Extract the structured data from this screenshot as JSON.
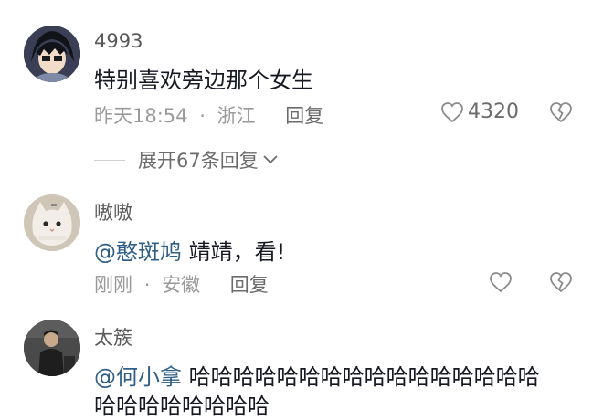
{
  "comments": [
    {
      "username": "4993",
      "text": "特别喜欢旁边那个女生",
      "time": "昨天18:54",
      "separator": "·",
      "location": "浙江",
      "reply_label": "回复",
      "likes": "4320",
      "expand_label": "展开67条回复"
    },
    {
      "username": "嗷嗷",
      "mention": "@憨斑鸠",
      "text": " 靖靖，看!",
      "time": "刚刚",
      "separator": "·",
      "location": "安徽",
      "reply_label": "回复"
    },
    {
      "username": "太簇",
      "mention": "@何小拿",
      "text": " 哈哈哈哈哈哈哈哈哈哈哈哈哈哈哈哈",
      "text_line2": "哈哈哈哈哈哈哈哈"
    }
  ],
  "colors": {
    "mention": "#2f5f86",
    "meta": "#9a9a9a",
    "text": "#161823"
  }
}
